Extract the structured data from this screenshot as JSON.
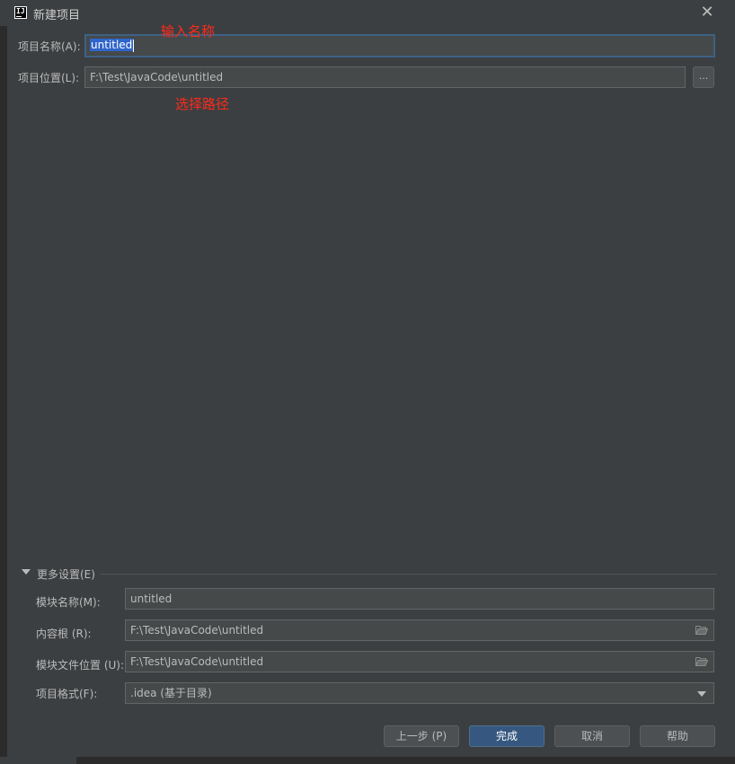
{
  "window": {
    "title": "新建项目",
    "icon_text": "IJ",
    "close_glyph": "✕"
  },
  "form": {
    "name_label": "项目名称(A):",
    "name_value": "untitled",
    "location_label": "项目位置(L):",
    "location_value": "F:\\Test\\JavaCode\\untitled",
    "browse_label": "..."
  },
  "annotations": {
    "name_hint": "输入名称",
    "path_hint": "选择路径"
  },
  "more_settings": {
    "toggle_label": "更多设置(E)",
    "module_name_label": "模块名称(M):",
    "module_name_value": "untitled",
    "content_root_label": "内容根 (R):",
    "content_root_value": "F:\\Test\\JavaCode\\untitled",
    "module_file_label": "模块文件位置 (U):",
    "module_file_value": "F:\\Test\\JavaCode\\untitled",
    "project_format_label": "项目格式(F):",
    "project_format_value": ".idea (基于目录)"
  },
  "buttons": {
    "previous": "上一步 (P)",
    "finish": "完成",
    "cancel": "取消",
    "help": "帮助"
  },
  "colors": {
    "background": "#3c3f41",
    "field": "#45494a",
    "focus_border": "#3d6185",
    "selection": "#2f65ca",
    "primary_button": "#365880",
    "annotation": "#ff2a1a"
  }
}
